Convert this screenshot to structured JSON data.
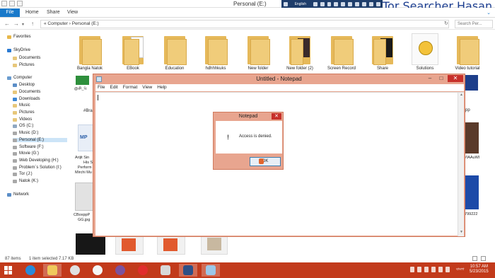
{
  "window": {
    "title": "Personal (E:)",
    "overlay_language": "English"
  },
  "brand_text": "Tor Searcher Hasan",
  "ribbon": {
    "tabs": [
      "File",
      "Home",
      "Share",
      "View"
    ]
  },
  "address": {
    "path": "« Computer › Personal (E:)",
    "search_placeholder": "Search Per..."
  },
  "navpane": {
    "favorites": "Favorites",
    "favorites_items": [
      "Documents",
      "Pictures"
    ],
    "skydrive": "SkyDrive",
    "skydrive_items": [
      "Documents",
      "Pictures"
    ],
    "computer": "Computer",
    "computer_items": [
      "Desktop",
      "Documents",
      "Downloads",
      "Music",
      "Pictures",
      "Videos",
      "OS (C:)",
      "Music (D:)",
      "Personal (E:)",
      "Software (F:)",
      "Movie (G:)",
      "Web Developing (H:)",
      "Problem`s Solution (I:)",
      "Tor (J:)",
      "Natok (K:)"
    ],
    "network": "Network"
  },
  "files": {
    "row1": [
      "Bangla Natok",
      "EBook",
      "Education",
      "hdhhhkuks",
      "New folder",
      "New folder (2)",
      "Screen Record",
      "Share",
      "Solutions",
      "Video tutorial"
    ],
    "partial_labels": [
      "@ক্রী_বি",
      "#Bra",
      "Arijit Sin",
      "His So",
      "Perform",
      "Mirchi Mu",
      "CBoxppP",
      "GG.jpg",
      "pp",
      "VIAAuWI",
      "1799222"
    ]
  },
  "status": {
    "items": "87 items",
    "selected": "1 item selected  7.17 KB"
  },
  "notepad": {
    "title": "Untitled - Notepad",
    "menu": [
      "File",
      "Edit",
      "Format",
      "View",
      "Help"
    ]
  },
  "dialog": {
    "title": "Notepad",
    "message": "Access is denied.",
    "ok_label": "OK"
  },
  "taskbar": {
    "lang": "বাংলা",
    "time": "10:57 AM",
    "date": "5/23/2015"
  },
  "colors": {
    "accent": "#1979ca",
    "taskbar": "#c23a1b",
    "window_frame": "#e8a58f",
    "close": "#c7302a"
  }
}
